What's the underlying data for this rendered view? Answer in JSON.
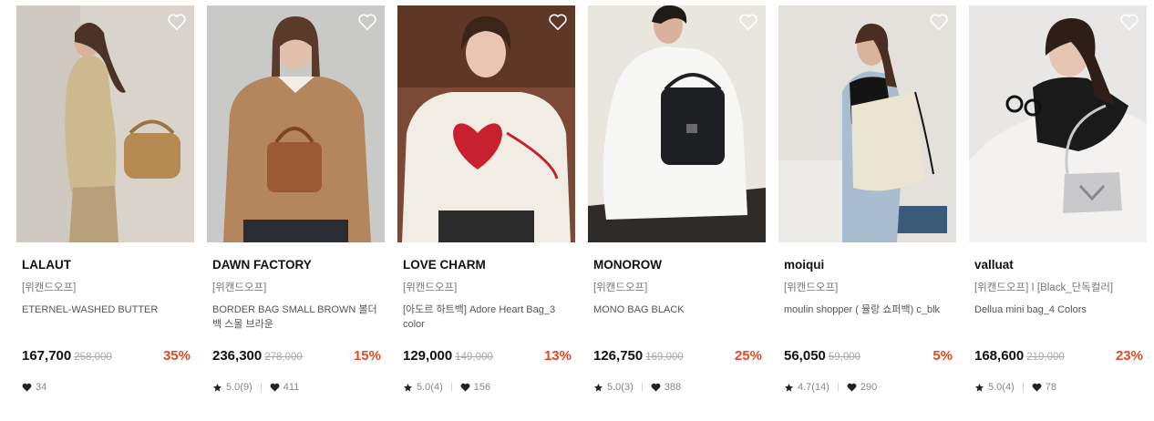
{
  "colors": {
    "discount": "#e8491e",
    "brand_text": "#111111",
    "muted_text": "#777777"
  },
  "products": [
    {
      "brand": "LALAUT",
      "tag": "[위캔드오프]",
      "name": "ETERNEL-WASHED BUTTER",
      "price": "167,700",
      "original_price": "258,000",
      "discount": "35%",
      "rating": "",
      "likes": "34",
      "wishlist_icon": "heart-outline-icon"
    },
    {
      "brand": "DAWN FACTORY",
      "tag": "[위캔드오프]",
      "name": "BORDER BAG SMALL BROWN 볼더백 스몰 브라운",
      "price": "236,300",
      "original_price": "278,000",
      "discount": "15%",
      "rating": "5.0(9)",
      "likes": "411",
      "wishlist_icon": "heart-outline-icon"
    },
    {
      "brand": "LOVE CHARM",
      "tag": "[위캔드오프]",
      "name": "[아도르 하트백] Adore Heart Bag_3 color",
      "price": "129,000",
      "original_price": "149,000",
      "discount": "13%",
      "rating": "5.0(4)",
      "likes": "156",
      "wishlist_icon": "heart-outline-icon"
    },
    {
      "brand": "MONOROW",
      "tag": "[위캔드오프]",
      "name": "MONO BAG BLACK",
      "price": "126,750",
      "original_price": "169,000",
      "discount": "25%",
      "rating": "5.0(3)",
      "likes": "388",
      "wishlist_icon": "heart-outline-icon"
    },
    {
      "brand": "moiqui",
      "tag": "[위캔드오프]",
      "name": "moulin shopper ( 뮬랑 쇼퍼백) c_blk",
      "price": "56,050",
      "original_price": "59,000",
      "discount": "5%",
      "rating": "4.7(14)",
      "likes": "290",
      "wishlist_icon": "heart-outline-icon"
    },
    {
      "brand": "valluat",
      "tag": "[위캔드오프] I [Black_단독컬러]",
      "name": "Dellua mini bag_4 Colors",
      "price": "168,600",
      "original_price": "219,000",
      "discount": "23%",
      "rating": "5.0(4)",
      "likes": "78",
      "wishlist_icon": "heart-outline-icon"
    }
  ]
}
